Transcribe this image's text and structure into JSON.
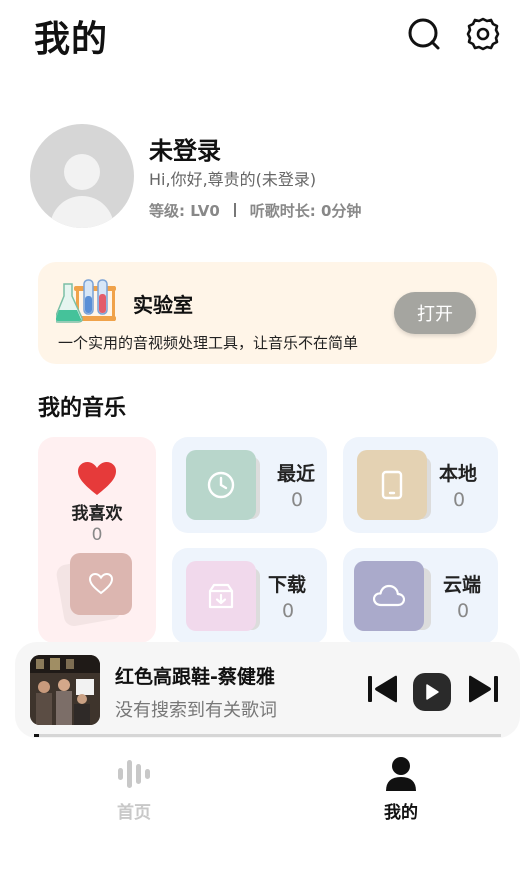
{
  "header": {
    "title": "我的",
    "icons": [
      "search-icon",
      "settings-gear-icon"
    ]
  },
  "profile": {
    "name": "未登录",
    "greeting": "Hi,你好,尊贵的(未登录)",
    "level": "等级: LV0",
    "listen_time": "听歌时长: 0分钟"
  },
  "lab": {
    "title": "实验室",
    "description": "一个实用的音视频处理工具，让音乐不在简单",
    "open_label": "打开",
    "icon": "test-tubes-icon"
  },
  "music": {
    "section_title": "我的音乐",
    "favorites": {
      "label": "我喜欢",
      "count": "0",
      "color": "#e63a3a"
    },
    "tiles": [
      {
        "label": "最近",
        "count": "0",
        "icon": "clock-icon",
        "color": "#b8d6cb"
      },
      {
        "label": "本地",
        "count": "0",
        "icon": "phone-icon",
        "color": "#e4d2b3"
      },
      {
        "label": "下载",
        "count": "0",
        "icon": "download-box-icon",
        "color": "#f1d9ec"
      },
      {
        "label": "云端",
        "count": "0",
        "icon": "cloud-icon",
        "color": "#aaaacb"
      }
    ]
  },
  "player": {
    "song_title": "红色高跟鞋-蔡健雅",
    "lyric": "没有搜索到有关歌词",
    "progress": 0.01
  },
  "tabbar": {
    "home": {
      "label": "首页",
      "icon": "sound-bars-icon",
      "color": "#c8c8c8"
    },
    "mine": {
      "label": "我的",
      "icon": "person-icon",
      "color": "#111111"
    }
  },
  "colors": {
    "lab_background": "#fff5e8",
    "favorites_background": "#fff0f1",
    "tile_background": "#eef4fc",
    "open_button": "#a5a5a0"
  }
}
